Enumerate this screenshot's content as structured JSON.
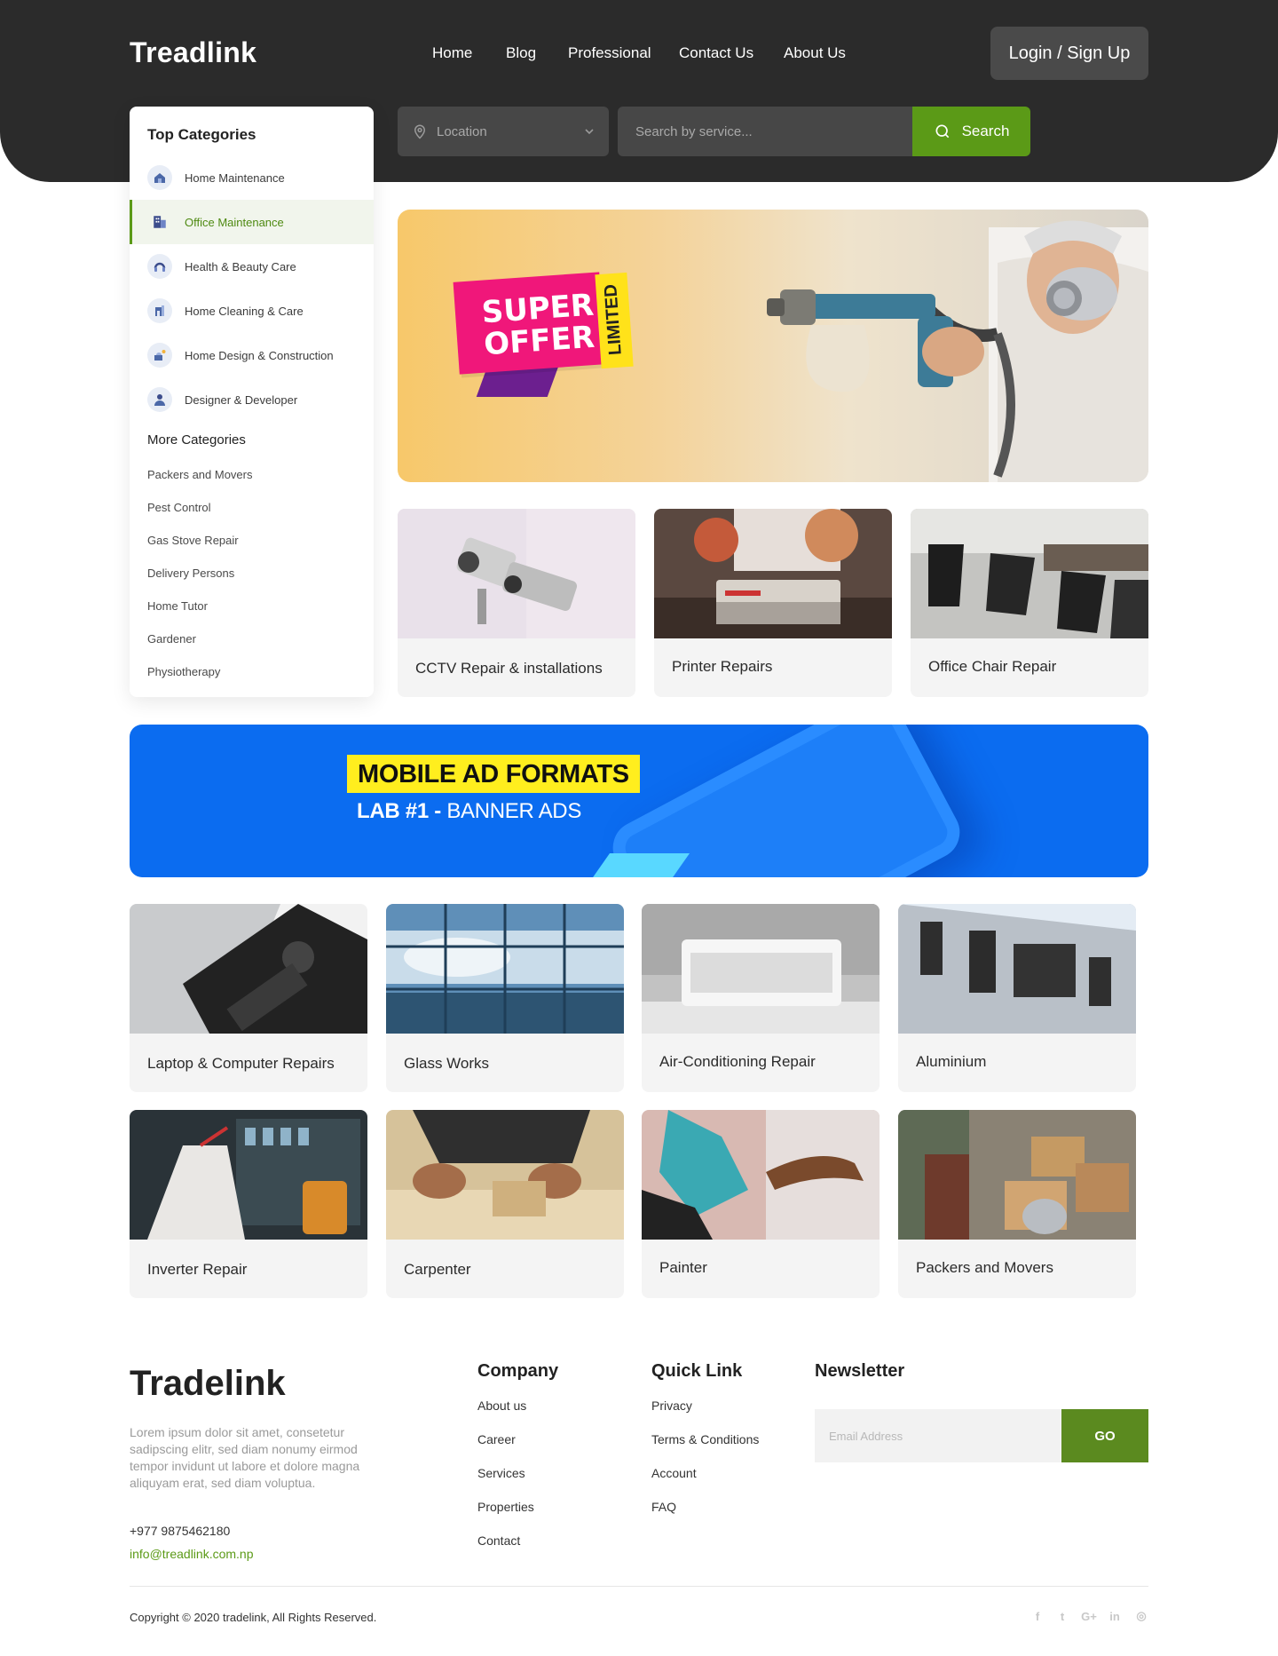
{
  "header": {
    "logo": "Treadlink",
    "nav": [
      "Home",
      "Blog",
      "Professional",
      "Contact Us",
      "About Us"
    ],
    "login_label": "Login / Sign Up",
    "location_placeholder": "Location",
    "search_placeholder": "Search by service...",
    "search_label": "Search"
  },
  "sidebar": {
    "title": "Top Categories",
    "items": [
      {
        "label": "Home Maintenance",
        "icon": "home-maintenance-icon"
      },
      {
        "label": "Office Maintenance",
        "icon": "office-building-icon",
        "active": true
      },
      {
        "label": "Health & Beauty Care",
        "icon": "health-beauty-icon"
      },
      {
        "label": "Home Cleaning & Care",
        "icon": "home-cleaning-icon"
      },
      {
        "label": "Home Design & Construction",
        "icon": "construction-icon"
      },
      {
        "label": "Designer & Developer",
        "icon": "designer-icon"
      }
    ],
    "more_title": "More Categories",
    "more": [
      "Packers and Movers",
      "Pest Control",
      "Gas Stove Repair",
      "Delivery Persons",
      "Home Tutor",
      "Gardener",
      "Physiotherapy"
    ]
  },
  "promo": {
    "offer_line1": "SUPER",
    "offer_line2": "OFFER",
    "offer_tag": "LIMITED"
  },
  "ad_banner": {
    "headline": "MOBILE AD FORMATS",
    "sub_bold": "LAB #1 -",
    "sub_rest": " BANNER ADS"
  },
  "featured": [
    "CCTV Repair & installations",
    "Printer Repairs",
    "Office Chair Repair"
  ],
  "services": [
    "Laptop & Computer Repairs",
    "Glass Works",
    "Air-Conditioning Repair",
    "Aluminium",
    "Inverter Repair",
    "Carpenter",
    "Painter",
    "Packers and Movers"
  ],
  "footer": {
    "logo": "Tradelink",
    "description": "Lorem ipsum dolor sit amet, consetetur sadipscing elitr, sed diam nonumy eirmod tempor invidunt ut labore et dolore magna aliquyam erat, sed diam voluptua.",
    "phone": "+977 9875462180",
    "email": "info@treadlink.com.np",
    "company_title": "Company",
    "company_links": [
      "About us",
      "Career",
      "Services",
      "Properties",
      "Contact"
    ],
    "quick_title": "Quick Link",
    "quick_links": [
      "Privacy",
      "Terms & Conditions",
      "Account",
      "FAQ"
    ],
    "newsletter_title": "Newsletter",
    "email_placeholder": "Email Address",
    "go_label": "GO",
    "copyright": "Copyright © 2020 tradelink, All Rights Reserved.",
    "social": [
      {
        "icon": "facebook-icon",
        "glyph": "f"
      },
      {
        "icon": "twitter-icon",
        "glyph": "t"
      },
      {
        "icon": "google-plus-icon",
        "glyph": "G+"
      },
      {
        "icon": "linkedin-icon",
        "glyph": "in"
      },
      {
        "icon": "instagram-icon",
        "glyph": "◎"
      }
    ]
  },
  "colors": {
    "dark": "#2b2b2b",
    "accent": "#5b9a17",
    "ad_blue": "#0b6cf0",
    "ad_yellow": "#ffee1e",
    "offer_pink": "#f0177a"
  }
}
